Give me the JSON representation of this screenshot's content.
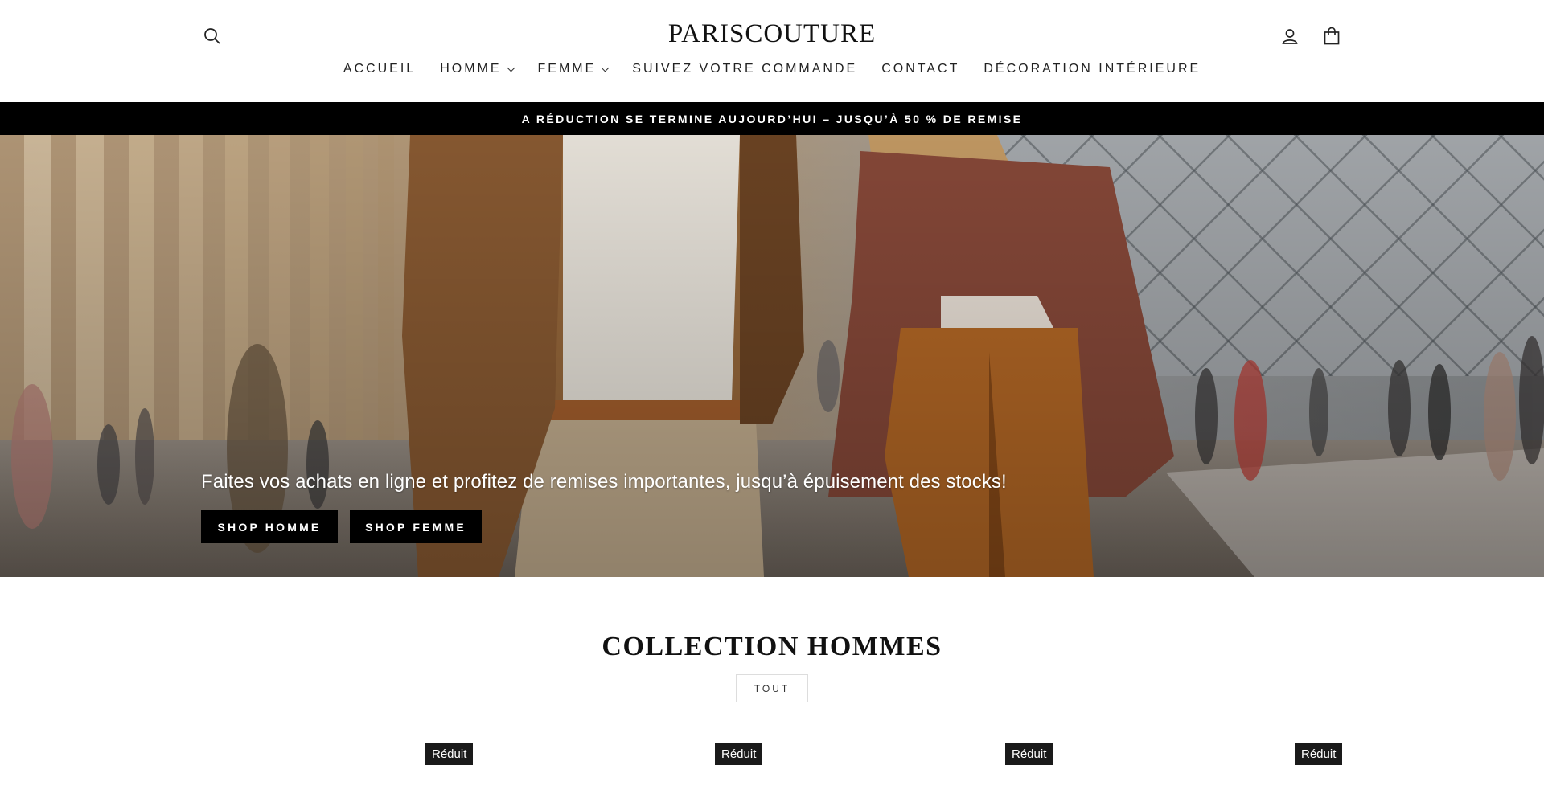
{
  "header": {
    "logo": "PARISCOUTURE",
    "icons": {
      "search": "search-icon",
      "account": "user-icon",
      "cart": "shopping-bag-icon"
    }
  },
  "nav": [
    {
      "label": "ACCUEIL",
      "dropdown": false
    },
    {
      "label": "HOMME",
      "dropdown": true
    },
    {
      "label": "FEMME",
      "dropdown": true
    },
    {
      "label": "SUIVEZ VOTRE COMMANDE",
      "dropdown": false
    },
    {
      "label": "CONTACT",
      "dropdown": false
    },
    {
      "label": "DÉCORATION INTÉRIEURE",
      "dropdown": false
    }
  ],
  "announcement": "A RÉDUCTION SE TERMINE AUJOURD’HUI – JUSQU’À 50 % DE REMISE",
  "hero": {
    "text": "Faites vos achats en ligne et profitez de remises importantes, jusqu’à épuisement des stocks!",
    "buttons": {
      "homme": "SHOP HOMME",
      "femme": "SHOP FEMME"
    }
  },
  "collection": {
    "title": "COLLECTION HOMMES",
    "filter": "TOUT",
    "badges": [
      "Réduit",
      "Réduit",
      "Réduit",
      "Réduit"
    ]
  },
  "colors": {
    "announcement_bg": "#000000",
    "button_bg": "#000000",
    "badge_bg": "#1a1a1a"
  }
}
